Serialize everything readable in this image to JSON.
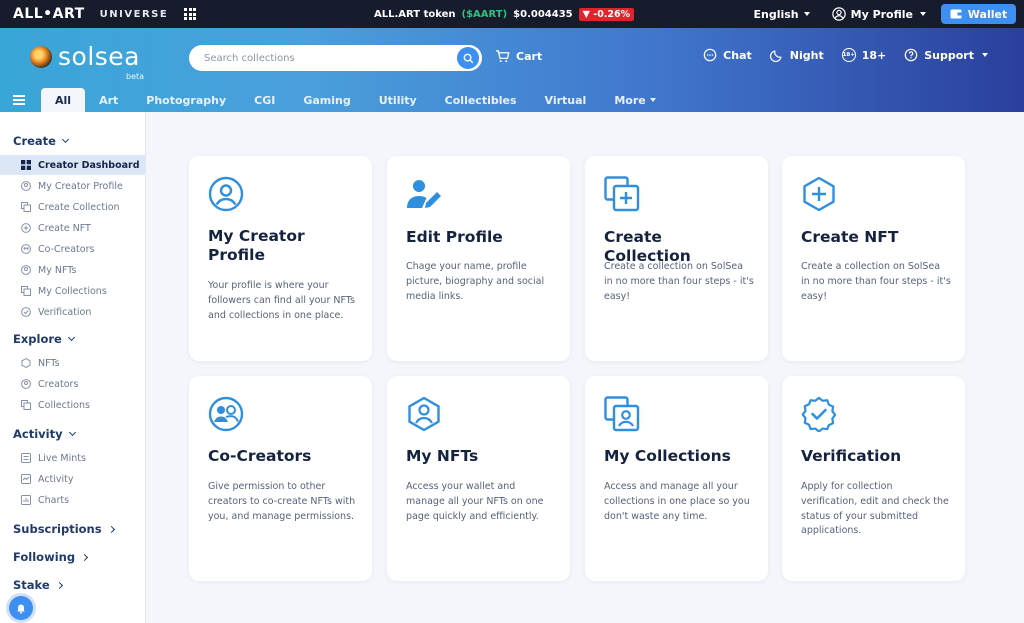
{
  "topbar": {
    "brand": "ALL•ART",
    "universe": "UNIVERSE",
    "token_label": "ALL.ART token",
    "token_symbol": "($AART)",
    "token_price": "$0.004435",
    "token_change": "▼ -0.26%",
    "language": "English",
    "profile": "My Profile",
    "wallet": "Wallet"
  },
  "header": {
    "logo": "solsea",
    "logo_beta": "beta",
    "search_placeholder": "Search collections",
    "cart": "Cart",
    "chat": "Chat",
    "night": "Night",
    "age": "18+",
    "age_badge": "18+",
    "support": "Support"
  },
  "nav": {
    "tabs": [
      "All",
      "Art",
      "Photography",
      "CGI",
      "Gaming",
      "Utility",
      "Collectibles",
      "Virtual"
    ],
    "more": "More"
  },
  "sidebar": {
    "create": "Create",
    "create_items": [
      "Creator Dashboard",
      "My Creator Profile",
      "Create Collection",
      "Create NFT",
      "Co-Creators",
      "My NFTs",
      "My Collections",
      "Verification"
    ],
    "explore": "Explore",
    "explore_items": [
      "NFTs",
      "Creators",
      "Collections"
    ],
    "activity": "Activity",
    "activity_items": [
      "Live Mints",
      "Activity",
      "Charts"
    ],
    "subscriptions": "Subscriptions",
    "following": "Following",
    "stake": "Stake"
  },
  "cards": [
    {
      "title": "My Creator Profile",
      "desc": "Your profile is where your followers can find all your NFTs and collections in one place.",
      "icon": "user-circle-icon"
    },
    {
      "title": "Edit Profile",
      "desc": "Chage your name, profile picture, biography and social media links.",
      "icon": "user-edit-icon"
    },
    {
      "title": "Create Collection",
      "desc": "Create a collection on SolSea in no more than four steps - it's easy!",
      "icon": "collection-add-icon"
    },
    {
      "title": "Create NFT",
      "desc": "Create a collection on SolSea in no more than four steps - it's easy!",
      "icon": "hexagon-plus-icon"
    },
    {
      "title": "Co-Creators",
      "desc": "Give permission to other creators to co-create NFTs with you, and manage permissions.",
      "icon": "users-circle-icon"
    },
    {
      "title": "My NFTs",
      "desc": "Access your wallet and manage all your NFTs on one page quickly and efficiently.",
      "icon": "hexagon-user-icon"
    },
    {
      "title": "My Collections",
      "desc": "Access and manage all your collections in one place so you don't waste any time.",
      "icon": "collection-user-icon"
    },
    {
      "title": "Verification",
      "desc": "Apply for collection verification, edit and check the status of your submitted applications.",
      "icon": "badge-check-icon"
    }
  ],
  "colors": {
    "accent": "#3d8ff2",
    "icon": "#2f8fdf",
    "topbar": "#171c2c"
  }
}
